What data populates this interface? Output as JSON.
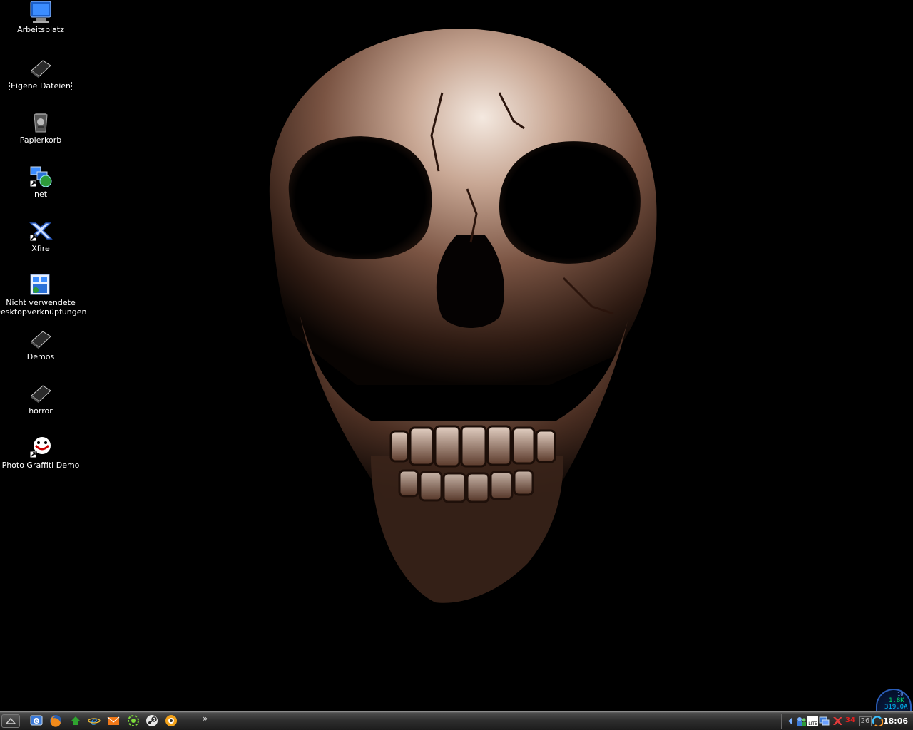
{
  "desktop": {
    "icons": [
      {
        "label": "Arbeitsplatz",
        "icon": "my-computer-icon"
      },
      {
        "label": "Eigene Dateien",
        "icon": "my-documents-icon",
        "selected": true
      },
      {
        "label": "Papierkorb",
        "icon": "recycle-bin-icon"
      },
      {
        "label": "net",
        "icon": "network-shortcut-icon"
      },
      {
        "label": "Xfire",
        "icon": "xfire-icon"
      },
      {
        "label": "Nicht verwendete\nDesktopverknüpfungen",
        "icon": "unused-shortcuts-folder-icon"
      },
      {
        "label": "Demos",
        "icon": "folder-icon"
      },
      {
        "label": "horror",
        "icon": "folder-icon"
      },
      {
        "label": "Photo Graffiti Demo",
        "icon": "photo-graffiti-icon"
      }
    ],
    "wallpaper": "skull"
  },
  "taskbar": {
    "quick_launch": [
      "show-desktop-icon",
      "firefox-icon",
      "limewire-icon",
      "internet-explorer-icon",
      "mail-icon",
      "apps-icon",
      "steam-icon",
      "messenger-icon"
    ],
    "more": "»",
    "tray": {
      "clock": "18:06",
      "icons": [
        "expand-arrow-icon",
        "network-users-icon",
        "lite-icon",
        "monitor-icon",
        "xfire-tray-icon",
        "temperature-icon",
        "calendar-icon",
        "refresh-icon"
      ],
      "temperature": "34",
      "day": "26"
    }
  },
  "net_meter": {
    "top": "10",
    "up": "1.8K",
    "down": "319.0A"
  },
  "colors": {
    "taskbar": "#2f2f2f",
    "skull": "#b08a70",
    "net_meter_border": "#2a5db8"
  }
}
